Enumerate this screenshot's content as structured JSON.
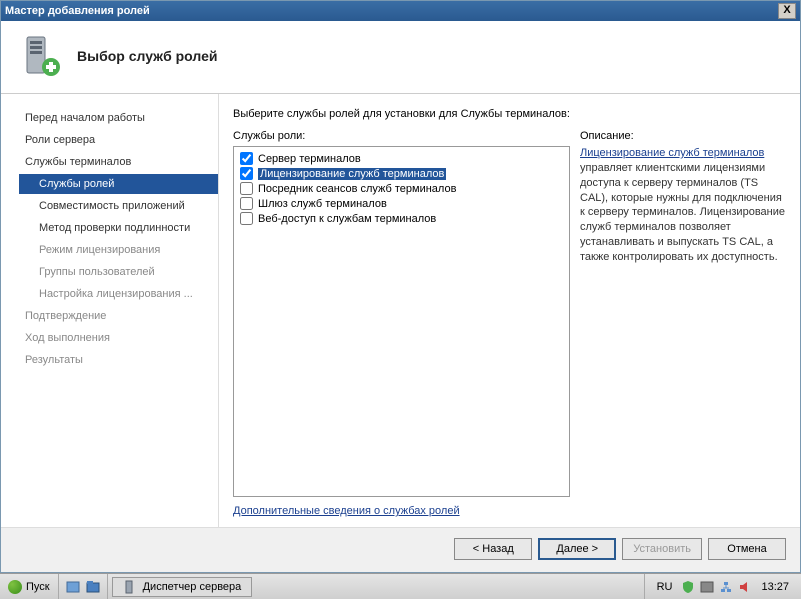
{
  "window": {
    "title": "Мастер добавления ролей",
    "close": "X"
  },
  "header": {
    "title": "Выбор служб ролей"
  },
  "sidebar": {
    "items": [
      {
        "label": "Перед началом работы",
        "sub": false,
        "disabled": false
      },
      {
        "label": "Роли сервера",
        "sub": false,
        "disabled": false
      },
      {
        "label": "Службы терминалов",
        "sub": false,
        "disabled": false
      },
      {
        "label": "Службы ролей",
        "sub": true,
        "disabled": false,
        "selected": true
      },
      {
        "label": "Совместимость приложений",
        "sub": true,
        "disabled": false
      },
      {
        "label": "Метод проверки подлинности",
        "sub": true,
        "disabled": false
      },
      {
        "label": "Режим лицензирования",
        "sub": true,
        "disabled": true
      },
      {
        "label": "Группы пользователей",
        "sub": true,
        "disabled": true
      },
      {
        "label": "Настройка лицензирования ...",
        "sub": true,
        "disabled": true
      },
      {
        "label": "Подтверждение",
        "sub": false,
        "disabled": true
      },
      {
        "label": "Ход выполнения",
        "sub": false,
        "disabled": true
      },
      {
        "label": "Результаты",
        "sub": false,
        "disabled": true
      }
    ]
  },
  "main": {
    "instruction": "Выберите службы ролей для установки для Службы терминалов:",
    "roles_label": "Службы роли:",
    "roles": [
      {
        "label": "Сервер терминалов",
        "checked": true,
        "selected": false
      },
      {
        "label": "Лицензирование служб терминалов",
        "checked": true,
        "selected": true
      },
      {
        "label": "Посредник сеансов служб терминалов",
        "checked": false,
        "selected": false
      },
      {
        "label": "Шлюз служб терминалов",
        "checked": false,
        "selected": false
      },
      {
        "label": "Веб-доступ к службам терминалов",
        "checked": false,
        "selected": false
      }
    ],
    "desc_label": "Описание:",
    "desc_link": "Лицензирование служб терминалов",
    "desc_text": " управляет клиентскими лицензиями доступа к серверу терминалов (TS CAL), которые нужны для подключения к серверу терминалов. Лицензирование служб терминалов позволяет устанавливать и выпускать TS CAL, а также контролировать их доступность.",
    "more_link": "Дополнительные сведения о службах ролей"
  },
  "footer": {
    "back": "< Назад",
    "next": "Далее >",
    "install": "Установить",
    "cancel": "Отмена"
  },
  "taskbar": {
    "start": "Пуск",
    "task": "Диспетчер сервера",
    "lang": "RU",
    "clock": "13:27"
  }
}
